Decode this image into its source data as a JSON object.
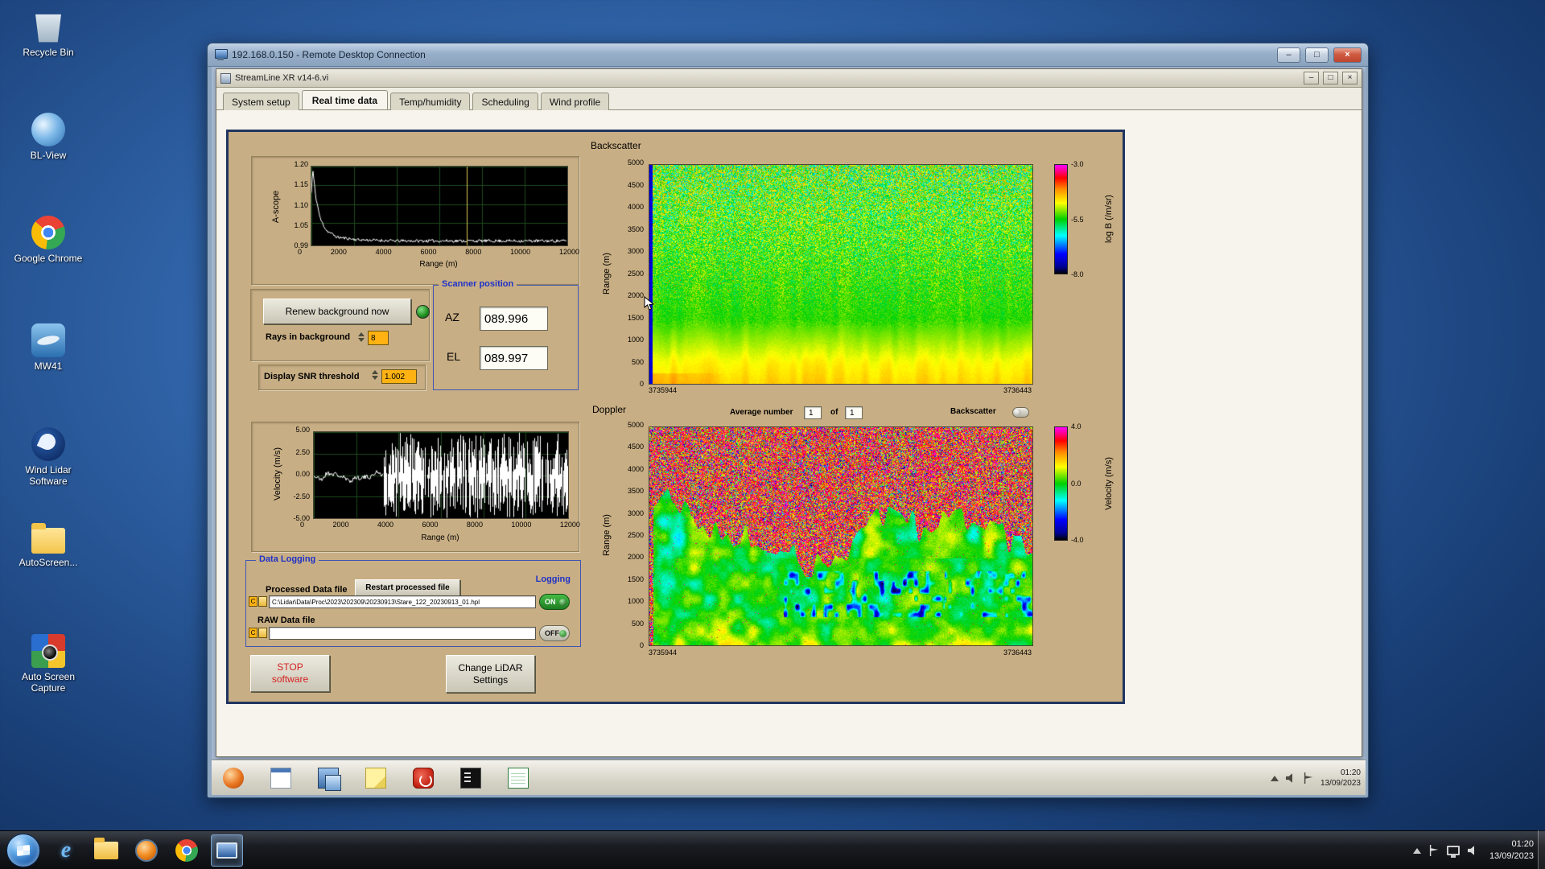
{
  "rdp": {
    "title": "192.168.0.150 - Remote Desktop Connection",
    "taskbar": {
      "time": "01:20",
      "date": "13/09/2023"
    }
  },
  "app": {
    "title": "StreamLine XR v14-6.vi",
    "tabs": [
      "System setup",
      "Real time data",
      "Temp/humidity",
      "Scheduling",
      "Wind profile"
    ],
    "active_tab": "Real time data"
  },
  "panel": {
    "controls": {
      "renew_button": "Renew background now",
      "rays_label": "Rays in background",
      "rays_value": "8",
      "snr_label": "Display SNR threshold",
      "snr_value": "1.002"
    },
    "scanner": {
      "title": "Scanner position",
      "az_label": "AZ",
      "az_value": "089.996",
      "el_label": "EL",
      "el_value": "089.997"
    },
    "doppler_bar": {
      "avg_label": "Average number",
      "avg_value": "1",
      "of_label": "of",
      "count_value": "1",
      "toggle_label": "Backscatter"
    },
    "logging": {
      "title": "Data Logging",
      "logging_label": "Logging",
      "processed_label": "Processed Data file",
      "restart_button": "Restart processed file",
      "path_badge": "C",
      "processed_path": "C:\\Lidar\\Data\\Proc\\2023\\202309\\20230913\\Stare_122_20230913_01.hpl",
      "processed_state": "ON",
      "raw_label": "RAW Data file",
      "raw_path": "",
      "raw_state": "OFF"
    },
    "actions": {
      "stop_line1": "STOP",
      "stop_line2": "software",
      "settings_line1": "Change LiDAR",
      "settings_line2": "Settings"
    }
  },
  "host": {
    "desktop_icons": [
      {
        "label": "Recycle Bin"
      },
      {
        "label": "BL-View"
      },
      {
        "label": "Google Chrome"
      },
      {
        "label": "MW41"
      },
      {
        "label": "Wind Lidar Software"
      },
      {
        "label": "AutoScreen..."
      },
      {
        "label": "Auto Screen Capture"
      }
    ],
    "taskbar": {
      "time": "01:20",
      "date": "13/09/2023"
    }
  },
  "icons": {
    "minimize": "–",
    "maximize": "□",
    "close": "×",
    "ie_letter": "e",
    "tray_arrow": "▲"
  },
  "colors": {
    "panel_tan": "#c8ae84",
    "value_orange": "#ffb212",
    "group_title_blue": "#1f32c8",
    "stop_red": "#d42020",
    "toggle_on_green": "#2da32d",
    "led_green": "#2fae2f"
  },
  "chart_data": [
    {
      "id": "ascope",
      "type": "line",
      "ylabel": "A-scope",
      "xlabel": "Range (m)",
      "ylim": [
        0.99,
        1.2
      ],
      "yticks": [
        "1.20",
        "1.15",
        "1.10",
        "1.05",
        "0.99"
      ],
      "xlim": [
        0,
        12000
      ],
      "xticks": [
        "0",
        "2000",
        "4000",
        "6000",
        "8000",
        "10000",
        "12000"
      ],
      "points": [
        [
          0,
          1.13
        ],
        [
          60,
          1.195
        ],
        [
          200,
          1.12
        ],
        [
          420,
          1.06
        ],
        [
          700,
          1.03
        ],
        [
          1200,
          1.012
        ],
        [
          2200,
          1.005
        ],
        [
          4000,
          1.002
        ],
        [
          12000,
          1.002
        ]
      ],
      "noise": 0.004,
      "cursor_x": 7300,
      "cursor_color": "#d8c84e",
      "line_color": "#ffffff",
      "bg": "#000000",
      "grid_color": "#1c4a1c",
      "seed": 11,
      "description": "SNR A-scope: peak ~1.20 near range 0 decaying to ~1.00 noise floor by ~2000 m, flat to 12000 m, yellow cursor near 7300 m"
    },
    {
      "id": "velocity",
      "type": "line",
      "ylabel": "Velocity (m/s)",
      "xlabel": "Range (m)",
      "ylim": [
        -5,
        5
      ],
      "yticks": [
        "5.00",
        "2.50",
        "0.00",
        "-2.50",
        "-5.00"
      ],
      "xlim": [
        0,
        12000
      ],
      "xticks": [
        "0",
        "2000",
        "4000",
        "6000",
        "8000",
        "10000",
        "12000"
      ],
      "quiet_until_x": 3300,
      "quiet_amp": 0.9,
      "spike_amp": 5,
      "line_color": "#ffffff",
      "bg": "#000000",
      "grid_color": "#1c4a1c",
      "seed": 21,
      "description": "Doppler velocity trace: small fluctuations (about ±1 m/s) out to ~3300 m, then saturated random spikes spanning ±5 m/s to 12000 m"
    },
    {
      "id": "backscatter",
      "type": "heatmap",
      "title": "Backscatter",
      "ylabel": "Range (m)",
      "ylim": [
        0,
        5000
      ],
      "yticks": [
        "5000",
        "4500",
        "4000",
        "3500",
        "3000",
        "2500",
        "2000",
        "1500",
        "1000",
        "500",
        "0"
      ],
      "xticks": [
        "3735944",
        "3736443"
      ],
      "colorbar": {
        "label": "log B (/m/sr)",
        "ticks": [
          "-3.0",
          "-5.5",
          "-8.0"
        ],
        "lim": [
          -3.0,
          -8.0
        ]
      },
      "colormap": [
        [
          0,
          "#000000"
        ],
        [
          0.06,
          "#000090"
        ],
        [
          0.18,
          "#0000ff"
        ],
        [
          0.35,
          "#00ffff"
        ],
        [
          0.5,
          "#00d000"
        ],
        [
          0.65,
          "#ffff00"
        ],
        [
          0.78,
          "#ff8800"
        ],
        [
          0.88,
          "#ff0000"
        ],
        [
          1,
          "#ff00ff"
        ]
      ],
      "seed": 31,
      "description": "Time-height backscatter: bright yellow/orange aerosol layer below ~700 m fading through yellow-green to a uniform green noise field with speckle increasing toward 5000 m"
    },
    {
      "id": "doppler",
      "type": "heatmap",
      "title": "Doppler",
      "ylabel": "Range (m)",
      "ylim": [
        0,
        5000
      ],
      "yticks": [
        "5000",
        "4500",
        "4000",
        "3500",
        "3000",
        "2500",
        "2000",
        "1500",
        "1000",
        "500",
        "0"
      ],
      "xticks": [
        "3735944",
        "3736443"
      ],
      "colorbar": {
        "label": "Velocity (m/s)",
        "ticks": [
          "4.0",
          "0.0",
          "-4.0"
        ],
        "lim": [
          4.0,
          -4.0
        ]
      },
      "colormap": [
        [
          0,
          "#000000"
        ],
        [
          0.06,
          "#000090"
        ],
        [
          0.18,
          "#0000ff"
        ],
        [
          0.35,
          "#00ffff"
        ],
        [
          0.5,
          "#00d000"
        ],
        [
          0.65,
          "#ffff00"
        ],
        [
          0.78,
          "#ff8800"
        ],
        [
          0.88,
          "#ff0000"
        ],
        [
          1,
          "#ff00ff"
        ]
      ],
      "seed": 41,
      "description": "Doppler velocity: green/yellow (~0 to +1 m/s) coherent field below a wavy ~2000-3000 m boundary, cyan/blue patches near 700-1600 m, magenta-dominated random noise above the aerosol layer"
    }
  ]
}
